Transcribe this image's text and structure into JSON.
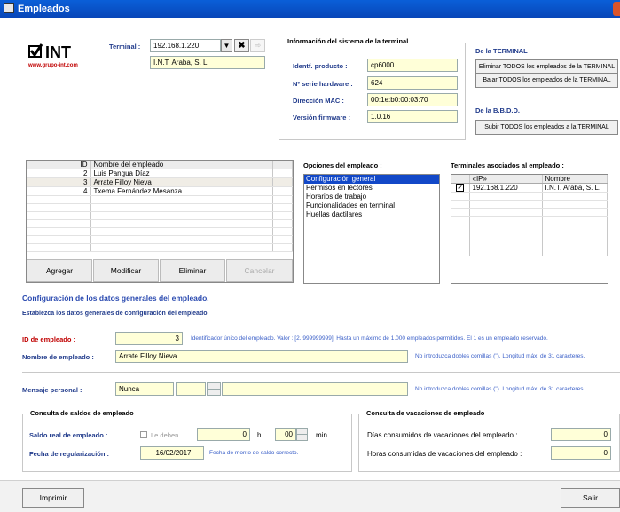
{
  "window": {
    "title": "Empleados"
  },
  "logo": {
    "brand": "INT",
    "url": "www.grupo-int.com"
  },
  "terminal": {
    "label": "Terminal :",
    "ip": "192.168.1.220",
    "company": "I.N.T. Araba, S. L."
  },
  "info": {
    "title": "Información del sistema de la terminal",
    "rows": [
      {
        "label": "Identf. producto :",
        "value": "cp6000"
      },
      {
        "label": "Nº serie hardware :",
        "value": "624"
      },
      {
        "label": "Dirección MAC :",
        "value": "00:1e:b0:00:03:70"
      },
      {
        "label": "Versión firmware :",
        "value": "1.0.16"
      }
    ]
  },
  "terminal_actions": {
    "title": "De la TERMINAL",
    "delete_label": "Eliminar TODOS los empleados de la TERMINAL",
    "download_label": "Bajar TODOS los empleados de la TERMINAL"
  },
  "db_actions": {
    "title": "De la B.B.D.D.",
    "upload_label": "Subir TODOS los empleados a la TERMINAL"
  },
  "employees": {
    "headers": {
      "id": "ID",
      "name": "Nombre del empleado"
    },
    "rows": [
      {
        "id": "2",
        "name": "Luis Pangua Díaz"
      },
      {
        "id": "3",
        "name": "Arrate Filloy Nieva"
      },
      {
        "id": "4",
        "name": "Txema Fernández Mesanza"
      }
    ],
    "buttons": {
      "add": "Agregar",
      "edit": "Modificar",
      "delete": "Eliminar",
      "cancel": "Cancelar"
    }
  },
  "options": {
    "title": "Opciones del empleado :",
    "items": [
      "Configuración general",
      "Permisos en lectores",
      "Horarios de trabajo",
      "Funcionalidades en terminal",
      "Huellas dactilares"
    ]
  },
  "terminals_assoc": {
    "title": "Terminales asociados al empleado :",
    "headers": {
      "ip": "«IP»",
      "name": "Nombre"
    },
    "rows": [
      {
        "ip": "192.168.1.220",
        "name": "I.N.T. Araba, S. L."
      }
    ]
  },
  "config": {
    "title": "Configuración de los datos generales del empleado.",
    "subtitle": "Establezca los datos generales de configuración del empleado.",
    "id_label": "ID de empleado :",
    "id_value": "3",
    "id_hint": "Identificador único del empleado. Valor : [2..999999999]. Hasta un máximo de 1.000 empleados permitidos. El 1 es un empleado reservado.",
    "name_label": "Nombre de empleado :",
    "name_value": "Arrate Filloy Nieva",
    "name_hint": "No introduzca dobles comillas (\"). Longitud máx. de 31 caracteres.",
    "msg_label": "Mensaje personal :",
    "msg_value": "Nunca",
    "msg_hint": "No introduzca dobles comillas (\"). Longitud máx. de 31 caracteres."
  },
  "balance": {
    "title": "Consulta de saldos de empleado",
    "real_label": "Saldo real de empleado :",
    "owe_label": "Le deben",
    "hours": "0",
    "h_unit": "h.",
    "minutes": "00",
    "min_unit": "min.",
    "reg_label": "Fecha de regularización :",
    "reg_value": "16/02/2017",
    "reg_hint": "Fecha de monto de saldo correcto."
  },
  "vacations": {
    "title": "Consulta de vacaciones de empleado",
    "days_label": "Días consumidos de vacaciones del empleado :",
    "days_value": "0",
    "hours_label": "Horas consumidas de vacaciones del empleado :",
    "hours_value": "0"
  },
  "footer": {
    "print": "Imprimir",
    "exit": "Salir"
  }
}
